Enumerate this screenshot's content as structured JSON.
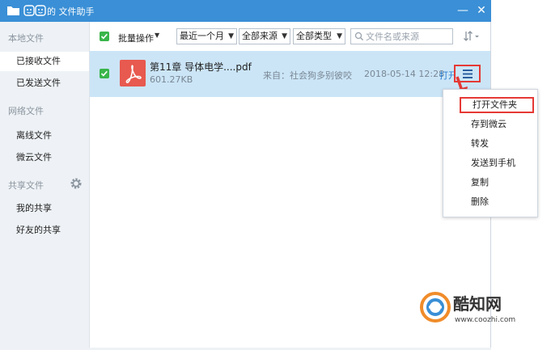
{
  "window": {
    "title": "的 文件助手",
    "minimize_glyph": "—",
    "close_glyph": "✕",
    "title_color": "#3a8fd6"
  },
  "sidebar": {
    "groups": [
      {
        "heading": "本地文件",
        "items": [
          "已接收文件",
          "已发送文件"
        ]
      },
      {
        "heading": "网络文件",
        "items": [
          "离线文件",
          "微云文件"
        ]
      },
      {
        "heading": "共享文件",
        "items": [
          "我的共享",
          "好友的共享"
        ]
      }
    ],
    "active_item": "已接收文件",
    "settings_icon": "gear-icon"
  },
  "toolbar": {
    "batch_label": "批量操作",
    "filters": [
      {
        "value": "最近一个月"
      },
      {
        "value": "全部来源"
      },
      {
        "value": "全部类型"
      }
    ],
    "search_placeholder": "文件名或来源",
    "sort_icon": "sort-icon"
  },
  "file": {
    "name": "第11章 导体电学....pdf",
    "size": "601.27KB",
    "source": "来自：社会狗多别彼咬",
    "time": "2018-05-14 12:28",
    "open_label": "打开",
    "checked": true,
    "type_icon": "pdf-icon"
  },
  "context_menu": {
    "items": [
      "打开文件夹",
      "存到微云",
      "转发",
      "发送到手机",
      "复制",
      "删除"
    ],
    "highlighted": "打开文件夹"
  },
  "watermark": {
    "text": "酷知网",
    "url": "www.coozhi.com"
  },
  "colors": {
    "accent": "#3a8fd6",
    "selected_row": "#cbe5f7",
    "checkbox": "#39b54a",
    "annotation_red": "#e53935",
    "link": "#2a7dd1"
  }
}
